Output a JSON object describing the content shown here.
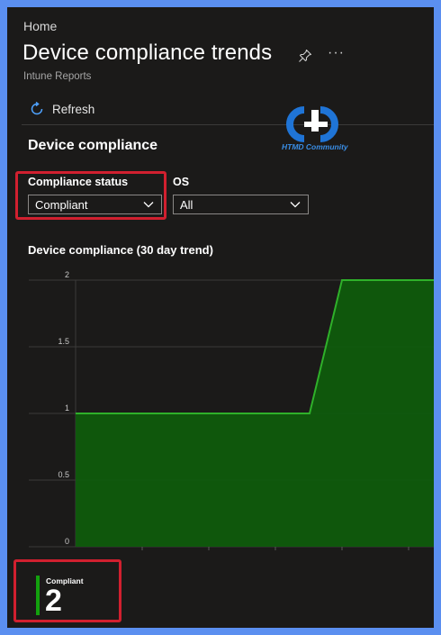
{
  "header": {
    "breadcrumb": "Home",
    "title": "Device compliance trends",
    "subtitle": "Intune Reports",
    "more_label": "···"
  },
  "toolbar": {
    "refresh_label": "Refresh"
  },
  "watermark": {
    "logo_text": "HTMD Community"
  },
  "section": {
    "title": "Device compliance"
  },
  "filters": {
    "compliance_status": {
      "label": "Compliance status",
      "value": "Compliant"
    },
    "os": {
      "label": "OS",
      "value": "All"
    }
  },
  "colors": {
    "accent": "#13a10e",
    "highlight": "#d1202f",
    "area_fill": "#0e5e0b",
    "line": "#2fb12a"
  },
  "chart_data": {
    "type": "area",
    "title": "Device compliance (30 day trend)",
    "y_ticks": [
      "2",
      "1.5",
      "1",
      "0.5",
      "0"
    ],
    "ylim": [
      0,
      2
    ],
    "x": [
      0,
      1,
      2,
      3,
      4,
      5
    ],
    "values": [
      1,
      1,
      1,
      1,
      1,
      2,
      2,
      2
    ],
    "grid": true
  },
  "kpi": {
    "label": "Compliant",
    "value": "2"
  }
}
